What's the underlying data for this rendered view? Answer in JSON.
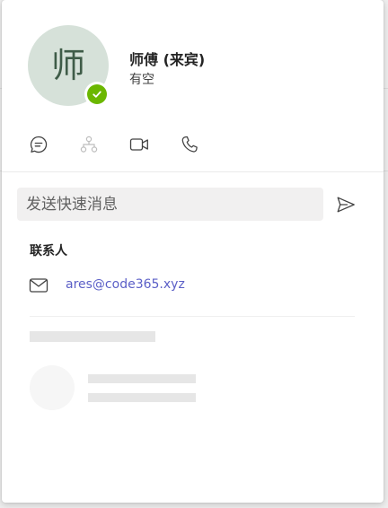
{
  "profile": {
    "avatar_initial": "师",
    "name": "师傅 (来宾)",
    "status": "有空",
    "presence_color": "#6bb700",
    "avatar_bg": "#d6e1d9"
  },
  "actions": [
    {
      "icon": "chat-icon",
      "label": "chat"
    },
    {
      "icon": "org-chart-icon",
      "label": "organization"
    },
    {
      "icon": "video-call-icon",
      "label": "video call"
    },
    {
      "icon": "phone-icon",
      "label": "audio call"
    }
  ],
  "quick_message": {
    "placeholder": "发送快速消息",
    "value": ""
  },
  "contact": {
    "title": "联系人",
    "email": "ares@code365.xyz",
    "email_icon": "mail-icon"
  },
  "colors": {
    "link": "#5b5fc7",
    "presence_available": "#6bb700"
  }
}
